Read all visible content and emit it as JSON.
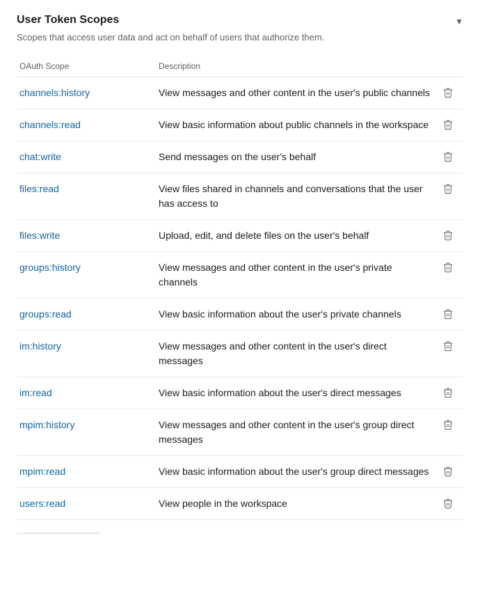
{
  "section": {
    "title": "User Token Scopes",
    "description": "Scopes that access user data and act on behalf of users that authorize them.",
    "chevron": "▼",
    "columns": {
      "scope": "OAuth Scope",
      "description": "Description"
    },
    "scopes": [
      {
        "id": "channels-history",
        "scope": "channels:history",
        "description": "View messages and other content in the user's public channels"
      },
      {
        "id": "channels-read",
        "scope": "channels:read",
        "description": "View basic information about public channels in the workspace"
      },
      {
        "id": "chat-write",
        "scope": "chat:write",
        "description": "Send messages on the user's behalf"
      },
      {
        "id": "files-read",
        "scope": "files:read",
        "description": "View files shared in channels and conversations that the user has access to"
      },
      {
        "id": "files-write",
        "scope": "files:write",
        "description": "Upload, edit, and delete files on the user's behalf"
      },
      {
        "id": "groups-history",
        "scope": "groups:history",
        "description": "View messages and other content in the user's private channels"
      },
      {
        "id": "groups-read",
        "scope": "groups:read",
        "description": "View basic information about the user's private channels"
      },
      {
        "id": "im-history",
        "scope": "im:history",
        "description": "View messages and other content in the user's direct messages"
      },
      {
        "id": "im-read",
        "scope": "im:read",
        "description": "View basic information about the user's direct messages"
      },
      {
        "id": "mpim-history",
        "scope": "mpim:history",
        "description": "View messages and other content in the user's group direct messages"
      },
      {
        "id": "mpim-read",
        "scope": "mpim:read",
        "description": "View basic information about the user's group direct messages"
      },
      {
        "id": "users-read",
        "scope": "users:read",
        "description": "View people in the workspace"
      }
    ]
  }
}
